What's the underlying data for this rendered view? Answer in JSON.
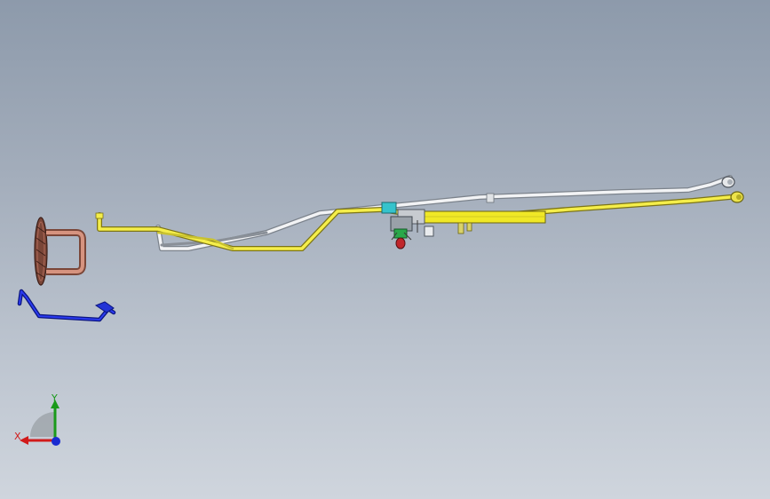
{
  "viewport": {
    "background_top": "#8d9aab",
    "background_bottom": "#cfd5dd"
  },
  "parts": [
    {
      "name": "grommet-seal",
      "color": "#c47f6d"
    },
    {
      "name": "blue-bracket",
      "color": "#1f2fd6"
    },
    {
      "name": "yellow-wire-harness",
      "color": "#f2ea3a"
    },
    {
      "name": "white-wire-harness",
      "color": "#e8eaec"
    },
    {
      "name": "connector-assembly",
      "color": "#2fb8c0"
    }
  ],
  "triad": {
    "x_label": "X",
    "y_label": "Y",
    "x_color": "#d11a1a",
    "y_color": "#1a9a1a",
    "z_color": "#1a2bd1"
  }
}
